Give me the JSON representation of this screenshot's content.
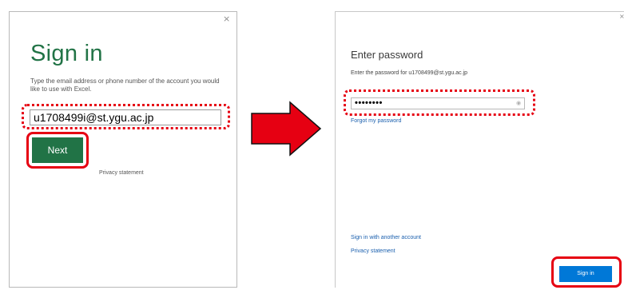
{
  "step1": {
    "close_glyph": "×",
    "title": "Sign in",
    "description": "Type the email address or phone number of the account you would like to use with Excel.",
    "email_value": "u1708499i@st.ygu.ac.jp",
    "next_label": "Next",
    "privacy_label": "Privacy statement"
  },
  "step2": {
    "close_glyph": "×",
    "title": "Enter password",
    "description": "Enter the password for u1708499@st.ygu.ac.jp",
    "password_value": "••••••••",
    "forgot_label": "Forgot my password",
    "another_account_label": "Sign in with another account",
    "privacy_label": "Privacy statement",
    "signin_label": "Sign in"
  },
  "colors": {
    "excel_green": "#217346",
    "highlight_red": "#e60012",
    "ms_blue": "#0078d7",
    "link_blue": "#1a5fae"
  },
  "icons": {
    "arrow": "right-arrow-icon",
    "password_reveal": "eye-icon",
    "close": "close-icon"
  }
}
